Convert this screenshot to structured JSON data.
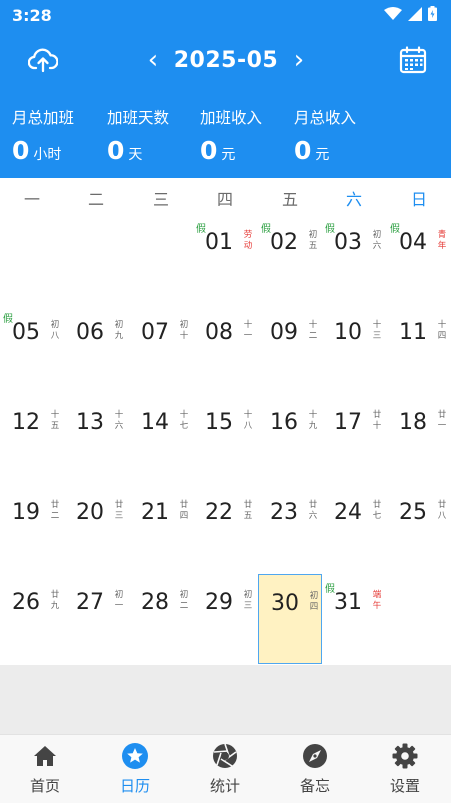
{
  "status_bar": {
    "time": "3:28"
  },
  "header": {
    "month_title": "2025-05",
    "prev_arrow": "‹",
    "next_arrow": "›"
  },
  "stats": [
    {
      "label": "月总加班",
      "value": "0",
      "unit": "小时"
    },
    {
      "label": "加班天数",
      "value": "0",
      "unit": "天"
    },
    {
      "label": "加班收入",
      "value": "0",
      "unit": "元"
    },
    {
      "label": "月总收入",
      "value": "0",
      "unit": "元"
    }
  ],
  "weekdays": [
    "一",
    "二",
    "三",
    "四",
    "五",
    "六",
    "日"
  ],
  "days": [
    {
      "d": "01",
      "lunar": [
        "劳",
        "动"
      ],
      "red": true,
      "holiday": "假"
    },
    {
      "d": "02",
      "lunar": [
        "初",
        "五"
      ],
      "holiday": "假"
    },
    {
      "d": "03",
      "lunar": [
        "初",
        "六"
      ],
      "holiday": "假"
    },
    {
      "d": "04",
      "lunar": [
        "青",
        "年"
      ],
      "red": true,
      "holiday": "假"
    },
    {
      "d": "05",
      "lunar": [
        "初",
        "八"
      ],
      "holiday": "假"
    },
    {
      "d": "06",
      "lunar": [
        "初",
        "九"
      ]
    },
    {
      "d": "07",
      "lunar": [
        "初",
        "十"
      ]
    },
    {
      "d": "08",
      "lunar": [
        "十",
        "一"
      ]
    },
    {
      "d": "09",
      "lunar": [
        "十",
        "二"
      ]
    },
    {
      "d": "10",
      "lunar": [
        "十",
        "三"
      ]
    },
    {
      "d": "11",
      "lunar": [
        "十",
        "四"
      ]
    },
    {
      "d": "12",
      "lunar": [
        "十",
        "五"
      ]
    },
    {
      "d": "13",
      "lunar": [
        "十",
        "六"
      ]
    },
    {
      "d": "14",
      "lunar": [
        "十",
        "七"
      ]
    },
    {
      "d": "15",
      "lunar": [
        "十",
        "八"
      ]
    },
    {
      "d": "16",
      "lunar": [
        "十",
        "九"
      ]
    },
    {
      "d": "17",
      "lunar": [
        "廿",
        "十"
      ]
    },
    {
      "d": "18",
      "lunar": [
        "廿",
        "一"
      ]
    },
    {
      "d": "19",
      "lunar": [
        "廿",
        "二"
      ]
    },
    {
      "d": "20",
      "lunar": [
        "廿",
        "三"
      ]
    },
    {
      "d": "21",
      "lunar": [
        "廿",
        "四"
      ]
    },
    {
      "d": "22",
      "lunar": [
        "廿",
        "五"
      ]
    },
    {
      "d": "23",
      "lunar": [
        "廿",
        "六"
      ]
    },
    {
      "d": "24",
      "lunar": [
        "廿",
        "七"
      ]
    },
    {
      "d": "25",
      "lunar": [
        "廿",
        "八"
      ]
    },
    {
      "d": "26",
      "lunar": [
        "廿",
        "九"
      ]
    },
    {
      "d": "27",
      "lunar": [
        "初",
        "一"
      ]
    },
    {
      "d": "28",
      "lunar": [
        "初",
        "二"
      ]
    },
    {
      "d": "29",
      "lunar": [
        "初",
        "三"
      ]
    },
    {
      "d": "30",
      "lunar": [
        "初",
        "四"
      ],
      "selected": true
    },
    {
      "d": "31",
      "lunar": [
        "端",
        "午"
      ],
      "red": true,
      "holiday": "假"
    }
  ],
  "tabs": [
    {
      "label": "首页",
      "icon": "home-icon"
    },
    {
      "label": "日历",
      "icon": "star-icon",
      "active": true
    },
    {
      "label": "统计",
      "icon": "aperture-icon"
    },
    {
      "label": "备忘",
      "icon": "compass-icon"
    },
    {
      "label": "设置",
      "icon": "gear-icon"
    }
  ],
  "colors": {
    "primary": "#1e8ef0",
    "selected_bg": "#fff2c2",
    "holiday": "#2ea043",
    "festival": "#e53935"
  }
}
